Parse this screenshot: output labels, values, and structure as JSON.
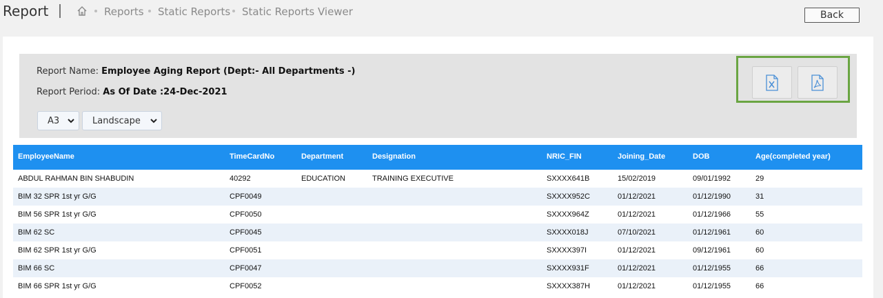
{
  "header": {
    "title": "Report",
    "breadcrumb": [
      "Reports",
      "Static Reports",
      "Static Reports Viewer"
    ],
    "back_label": "Back"
  },
  "report": {
    "name_label": "Report Name:",
    "name_value": "Employee Aging Report (Dept:- All Departments -)",
    "period_label": "Report Period:",
    "period_value": "As Of Date :24-Dec-2021",
    "page_size": "A3",
    "orientation": "Landscape"
  },
  "export": {
    "excel_icon": "excel-file-icon",
    "pdf_icon": "pdf-file-icon",
    "highlight_color": "#6aa542"
  },
  "colors": {
    "table_header": "#1e90f0",
    "alt_row": "#eaf1f9"
  },
  "table": {
    "columns": [
      "EmployeeName",
      "TimeCardNo",
      "Department",
      "Designation",
      "NRIC_FIN",
      "Joining_Date",
      "DOB",
      "Age(completed year)"
    ],
    "rows": [
      [
        "ABDUL RAHMAN BIN SHABUDIN",
        "40292",
        "EDUCATION",
        "TRAINING EXECUTIVE",
        "SXXXX641B",
        "15/02/2019",
        "09/01/1992",
        "29"
      ],
      [
        "BIM 32 SPR 1st yr G/G",
        "CPF0049",
        "",
        "",
        "SXXXX952C",
        "01/12/2021",
        "01/12/1990",
        "31"
      ],
      [
        "BIM 56 SPR 1st yr G/G",
        "CPF0050",
        "",
        "",
        "SXXXX964Z",
        "01/12/2021",
        "01/12/1966",
        "55"
      ],
      [
        "BIM 62 SC",
        "CPF0045",
        "",
        "",
        "SXXXX018J",
        "07/10/2021",
        "01/12/1961",
        "60"
      ],
      [
        "BIM 62 SPR 1st yr G/G",
        "CPF0051",
        "",
        "",
        "SXXXX397I",
        "01/12/2021",
        "09/12/1961",
        "60"
      ],
      [
        "BIM 66 SC",
        "CPF0047",
        "",
        "",
        "SXXXX931F",
        "01/12/2021",
        "01/12/1955",
        "66"
      ],
      [
        "BIM 66 SPR 1st yr G/G",
        "CPF0052",
        "",
        "",
        "SXXXX387H",
        "01/12/2021",
        "01/12/1955",
        "66"
      ]
    ]
  }
}
